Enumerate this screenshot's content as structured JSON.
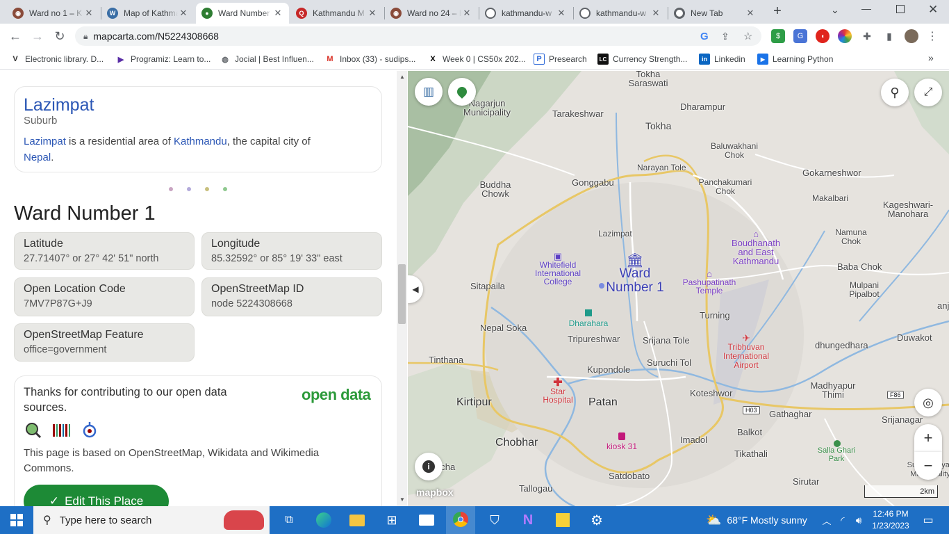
{
  "browser": {
    "tabs": [
      {
        "title": "Ward no 1 – K",
        "icon": "globe-icon",
        "color": "#8a4b3a"
      },
      {
        "title": "Map of Kathmandu",
        "icon": "wordpress-icon",
        "color": "#3a6ea5"
      },
      {
        "title": "Ward Number 1",
        "icon": "mapcarta-globe-icon",
        "color": "#2e7d32",
        "active": true
      },
      {
        "title": "Kathmandu M",
        "icon": "search-icon",
        "color": "#c62828"
      },
      {
        "title": "Ward no 24 – K",
        "icon": "globe-icon",
        "color": "#8a4b3a"
      },
      {
        "title": "kathmandu-w",
        "icon": "globe-icon",
        "color": "#5f6368"
      },
      {
        "title": "kathmandu-w",
        "icon": "globe-icon",
        "color": "#5f6368"
      },
      {
        "title": "New Tab",
        "icon": "chrome-icon",
        "color": "#5f6368"
      }
    ],
    "url": "mapcarta.com/N5224308668",
    "bookmarks": [
      {
        "label": "Electronic library. D...",
        "icon": "v-icon"
      },
      {
        "label": "Programiz: Learn to...",
        "icon": "programiz-icon"
      },
      {
        "label": "Jocial | Best Influen...",
        "icon": "globe-icon"
      },
      {
        "label": "Inbox (33) - sudips...",
        "icon": "gmail-icon"
      },
      {
        "label": "Week 0 | CS50x 202...",
        "icon": "x-icon"
      },
      {
        "label": "Presearch",
        "icon": "presearch-icon"
      },
      {
        "label": "Currency Strength...",
        "icon": "lc-icon"
      },
      {
        "label": "Linkedin",
        "icon": "linkedin-icon"
      },
      {
        "label": "Learning Python",
        "icon": "python-icon"
      }
    ]
  },
  "panel": {
    "place_title": "Lazimpat",
    "place_type": "Suburb",
    "desc_link1": "Lazimpat",
    "desc_text1": " is a residential area of ",
    "desc_link2": "Kathmandu",
    "desc_text2": ", the capital city of",
    "desc_link3": "Nepal",
    "desc_text3": ".",
    "heading": "Ward Number 1",
    "fields": [
      {
        "key": "Latitude",
        "value": "27.71407° or 27° 42' 51\" north"
      },
      {
        "key": "Longitude",
        "value": "85.32592° or 85° 19' 33\" east"
      },
      {
        "key": "Open Location Code",
        "value": "7MV7P87G+J9"
      },
      {
        "key": "OpenStreetMap ID",
        "value": "node 5224308668"
      },
      {
        "key": "OpenStreetMap Feature",
        "value": "office=government"
      }
    ],
    "thanks_text": "Thanks for contributing to our open data sources.",
    "open_data_logo": "open data",
    "based_on": "This page is based on OpenStreetMap, Wikidata and Wikimedia Commons.",
    "edit_button": "Edit This Place"
  },
  "map": {
    "labels": [
      {
        "text": "Tokha Saraswati"
      },
      {
        "text": "Nagarjun Municipality"
      },
      {
        "text": "Tarakeshwar"
      },
      {
        "text": "Dharampur"
      },
      {
        "text": "Tokha"
      },
      {
        "text": "Baluwakhani Chok"
      },
      {
        "text": "Narayan Tole"
      },
      {
        "text": "Gokarneshwor"
      },
      {
        "text": "Buddha Chowk"
      },
      {
        "text": "Gonggabu"
      },
      {
        "text": "Panchakumari Chok"
      },
      {
        "text": "Makalbari"
      },
      {
        "text": "Kageshwari-Manohara"
      },
      {
        "text": "Lazimpat"
      },
      {
        "text": "Namuna Chok"
      },
      {
        "text": "Baba Chok"
      },
      {
        "text": "Mulpani Pipalbot"
      },
      {
        "text": "Sitapaila"
      },
      {
        "text": "Turning"
      },
      {
        "text": "Nepal Soka"
      },
      {
        "text": "Tripureshwar"
      },
      {
        "text": "Srijana Tole"
      },
      {
        "text": "dhungedhara"
      },
      {
        "text": "Duwakot"
      },
      {
        "text": "Tinthana"
      },
      {
        "text": "Suruchi Tol"
      },
      {
        "text": "Kupondole"
      },
      {
        "text": "Madhyapur Thimi"
      },
      {
        "text": "Kirtipur"
      },
      {
        "text": "Patan"
      },
      {
        "text": "Koteshwor"
      },
      {
        "text": "Gathaghar"
      },
      {
        "text": "Srijanagar"
      },
      {
        "text": "Chobhar"
      },
      {
        "text": "Imadol"
      },
      {
        "text": "Balkot"
      },
      {
        "text": "Tikathali"
      },
      {
        "text": "Sirutar"
      },
      {
        "text": "Satdobato"
      },
      {
        "text": "Tallogau"
      },
      {
        "text": "ocha"
      },
      {
        "text": "anjad"
      },
      {
        "text": "Suryabinayak Municipality"
      }
    ],
    "pois": [
      {
        "text": "Whitefield International College",
        "color": "#5c3fc4"
      },
      {
        "text": "Boudhanath and East Kathmandu",
        "color": "#7b3fc4"
      },
      {
        "text": "Pashupatinath Temple",
        "color": "#7b3fc4"
      },
      {
        "text": "Dharahara",
        "color": "#1f9a8a"
      },
      {
        "text": "Tribhuvan International Airport",
        "color": "#d0343c"
      },
      {
        "text": "Star Hospital",
        "color": "#d0343c"
      },
      {
        "text": "kiosk 31",
        "color": "#c2187a"
      },
      {
        "text": "Salla Ghari Park",
        "color": "#3a8f4a"
      }
    ],
    "marker_label": "Ward Number 1",
    "road_badges": [
      "H03",
      "F86"
    ],
    "scale": "2km",
    "attribution": "mapbox"
  },
  "taskbar": {
    "search_placeholder": "Type here to search",
    "weather": "68°F  Mostly sunny",
    "time": "12:46 PM",
    "date": "1/23/2023"
  }
}
